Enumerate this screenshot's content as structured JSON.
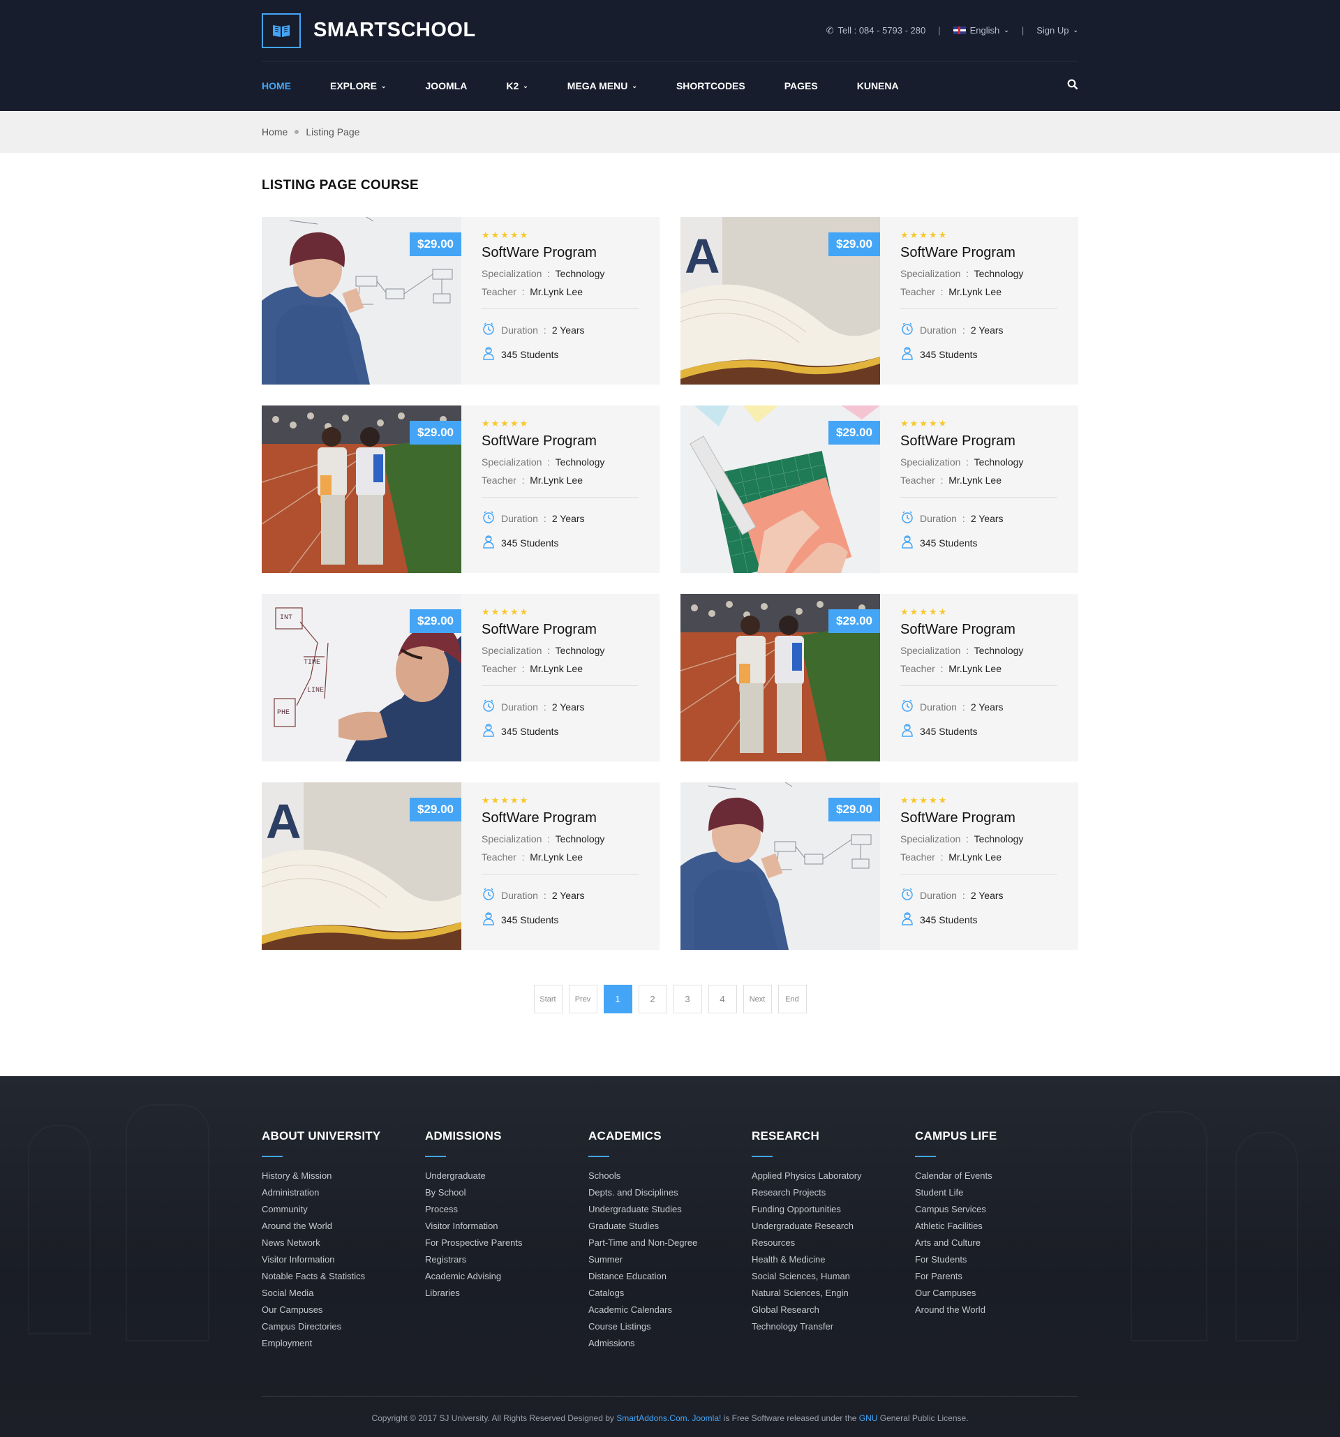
{
  "brand": {
    "name": "SMARTSCHOOL",
    "accent": "#44a5f7",
    "header_bg": "#171d2d"
  },
  "topbar": {
    "phone": "Tell : 084 - 5793 - 280",
    "language": "English",
    "signup": "Sign Up"
  },
  "nav": {
    "items": [
      {
        "label": "HOME",
        "active": true,
        "dropdown": false
      },
      {
        "label": "EXPLORE",
        "active": false,
        "dropdown": true
      },
      {
        "label": "JOOMLA",
        "active": false,
        "dropdown": false
      },
      {
        "label": "K2",
        "active": false,
        "dropdown": true
      },
      {
        "label": "MEGA MENU",
        "active": false,
        "dropdown": true
      },
      {
        "label": "SHORTCODES",
        "active": false,
        "dropdown": false
      },
      {
        "label": "PAGES",
        "active": false,
        "dropdown": false
      },
      {
        "label": "KUNENA",
        "active": false,
        "dropdown": false
      }
    ]
  },
  "breadcrumb": {
    "home": "Home",
    "current": "Listing Page"
  },
  "page": {
    "title": "LISTING PAGE COURSE"
  },
  "labels": {
    "specialization": "Specialization",
    "teacher": "Teacher",
    "duration": "Duration",
    "colon": ":"
  },
  "courses": [
    {
      "image": "man-whiteboard",
      "price": "$29.00",
      "rating": 4.5,
      "name": "SoftWare Program",
      "specialization": "Technology",
      "teacher": "Mr.Lynk Lee",
      "duration": "2 Years",
      "students": "345 Students"
    },
    {
      "image": "open-book",
      "price": "$29.00",
      "rating": 4.5,
      "name": "SoftWare Program",
      "specialization": "Technology",
      "teacher": "Mr.Lynk Lee",
      "duration": "2 Years",
      "students": "345 Students"
    },
    {
      "image": "running-track",
      "price": "$29.00",
      "rating": 4.5,
      "name": "SoftWare Program",
      "specialization": "Technology",
      "teacher": "Mr.Lynk Lee",
      "duration": "2 Years",
      "students": "345 Students"
    },
    {
      "image": "cutting-mat",
      "price": "$29.00",
      "rating": 4.5,
      "name": "SoftWare Program",
      "specialization": "Technology",
      "teacher": "Mr.Lynk Lee",
      "duration": "2 Years",
      "students": "345 Students"
    },
    {
      "image": "man-writing",
      "price": "$29.00",
      "rating": 4.5,
      "name": "SoftWare Program",
      "specialization": "Technology",
      "teacher": "Mr.Lynk Lee",
      "duration": "2 Years",
      "students": "345 Students"
    },
    {
      "image": "running-track",
      "price": "$29.00",
      "rating": 4.5,
      "name": "SoftWare Program",
      "specialization": "Technology",
      "teacher": "Mr.Lynk Lee",
      "duration": "2 Years",
      "students": "345 Students"
    },
    {
      "image": "open-book",
      "price": "$29.00",
      "rating": 4.5,
      "name": "SoftWare Program",
      "specialization": "Technology",
      "teacher": "Mr.Lynk Lee",
      "duration": "2 Years",
      "students": "345 Students"
    },
    {
      "image": "man-whiteboard",
      "price": "$29.00",
      "rating": 4.5,
      "name": "SoftWare Program",
      "specialization": "Technology",
      "teacher": "Mr.Lynk Lee",
      "duration": "2 Years",
      "students": "345 Students"
    }
  ],
  "pagination": {
    "items": [
      {
        "label": "Start",
        "small": true,
        "active": false
      },
      {
        "label": "Prev",
        "small": true,
        "active": false
      },
      {
        "label": "1",
        "small": false,
        "active": true
      },
      {
        "label": "2",
        "small": false,
        "active": false
      },
      {
        "label": "3",
        "small": false,
        "active": false
      },
      {
        "label": "4",
        "small": false,
        "active": false
      },
      {
        "label": "Next",
        "small": true,
        "active": false
      },
      {
        "label": "End",
        "small": true,
        "active": false
      }
    ]
  },
  "footer": {
    "columns": [
      {
        "title": "ABOUT UNIVERSITY",
        "links": [
          "History & Mission",
          "Administration",
          "Community",
          "Around the World",
          "News Network",
          "Visitor Information",
          "Notable Facts & Statistics",
          "Social Media",
          "Our Campuses",
          "Campus Directories",
          "Employment"
        ]
      },
      {
        "title": "ADMISSIONS",
        "links": [
          "Undergraduate",
          "By School",
          "Process",
          "Visitor Information",
          "For Prospective Parents",
          "Registrars",
          "Academic Advising",
          "Libraries"
        ]
      },
      {
        "title": "ACADEMICS",
        "links": [
          "Schools",
          "Depts. and Disciplines",
          "Undergraduate Studies",
          "Graduate Studies",
          "Part-Time and Non-Degree",
          "Summer",
          "Distance Education",
          "Catalogs",
          "Academic Calendars",
          "Course Listings",
          "Admissions"
        ]
      },
      {
        "title": "RESEARCH",
        "links": [
          "Applied Physics Laboratory",
          "Research Projects",
          "Funding Opportunities",
          "Undergraduate Research",
          "Resources",
          "Health & Medicine",
          "Social Sciences, Human",
          "Natural Sciences, Engin",
          "Global Research",
          "Technology Transfer"
        ]
      },
      {
        "title": "CAMPUS LIFE",
        "links": [
          "Calendar of Events",
          "Student Life",
          "Campus Services",
          "Athletic Facilities",
          "Arts and Culture",
          "For Students",
          "For Parents",
          "Our Campuses",
          "Around the World"
        ]
      }
    ],
    "copyright": {
      "part1": "Copyright © 2017 SJ University. All Rights Reserved Designed by ",
      "link1": "SmartAddons.Com.",
      "part2": " ",
      "link2": "Joomla!",
      "part3": " is Free Software released under the ",
      "link3": "GNU",
      "part4": " General Public License."
    }
  }
}
